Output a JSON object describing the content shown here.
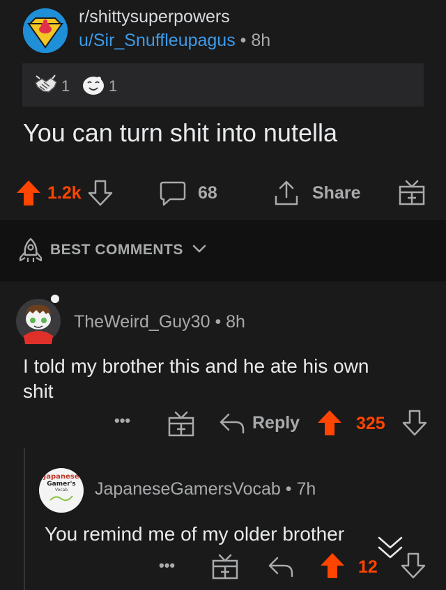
{
  "post": {
    "subreddit": "r/shittysuperpowers",
    "author": "u/Sir_Snuffleupagus",
    "time": "8h",
    "awards": [
      {
        "icon": "handshake-award-icon",
        "count": "1"
      },
      {
        "icon": "wholesome-award-icon",
        "count": "1"
      }
    ],
    "title": "You can turn shit into nutella",
    "score": "1.2k",
    "comments": "68",
    "share_label": "Share"
  },
  "sort": {
    "label": "BEST COMMENTS"
  },
  "comments": [
    {
      "author": "TheWeird_Guy30",
      "time": "8h",
      "text_line1": "I told my brother this and he ate his own",
      "text_line2": "shit",
      "more": "•••",
      "reply_label": "Reply",
      "score": "325"
    },
    {
      "author": "JapaneseGamersVocab",
      "time": "7h",
      "avatar_text": [
        "Japanese",
        "Gamer's",
        "Vocab"
      ],
      "text": "You remind me of my older brother",
      "more": "•••",
      "score": "12"
    }
  ],
  "colors": {
    "background": "#1a1a1b",
    "upvote": "#ff4500",
    "link": "#3d9be9",
    "muted": "#a8aaab"
  }
}
